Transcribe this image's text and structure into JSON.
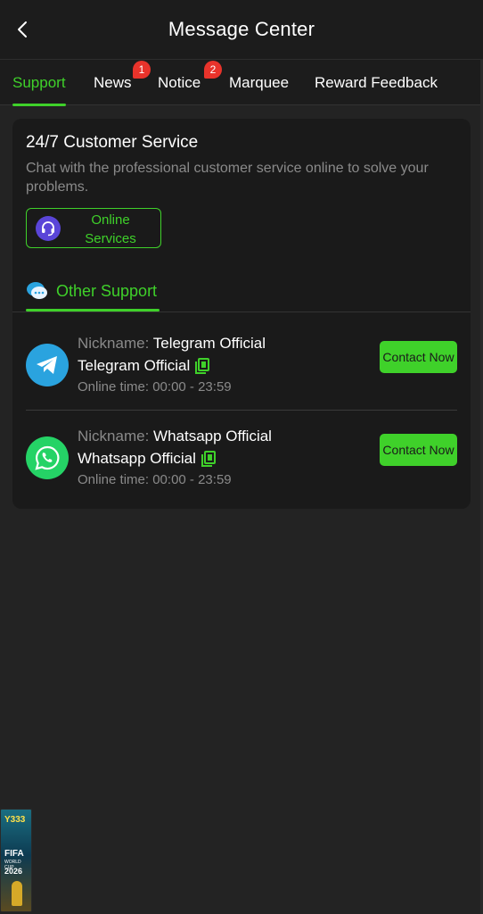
{
  "header": {
    "title": "Message Center",
    "back_icon": "chevron-left-icon"
  },
  "tabs": [
    {
      "label": "Support",
      "active": true,
      "badge": null
    },
    {
      "label": "News",
      "active": false,
      "badge": "1"
    },
    {
      "label": "Notice",
      "active": false,
      "badge": "2"
    },
    {
      "label": "Marquee",
      "active": false,
      "badge": null
    },
    {
      "label": "Reward Feedback",
      "active": false,
      "badge": null
    }
  ],
  "customer_service": {
    "title": "24/7 Customer Service",
    "description": "Chat with the professional customer service online to solve your problems.",
    "button_label": "Online Services",
    "button_icon": "headset-icon"
  },
  "other_support": {
    "label": "Other Support",
    "icon": "chat-bubble-icon"
  },
  "contacts": [
    {
      "icon": "telegram-icon",
      "nickname_key": "Nickname:",
      "nickname": "Telegram Official",
      "account": "Telegram Official",
      "online_time_key": "Online time:",
      "online_time": "00:00 - 23:59",
      "button": "Contact Now"
    },
    {
      "icon": "whatsapp-icon",
      "nickname_key": "Nickname:",
      "nickname": "Whatsapp Official",
      "account": "Whatsapp Official",
      "online_time_key": "Online time:",
      "online_time": "00:00 - 23:59",
      "button": "Contact Now"
    }
  ],
  "promo": {
    "logo": "Y333",
    "line1": "FIFA",
    "line2": "WORLD CUP",
    "line3": "2026"
  },
  "colors": {
    "accent": "#3fd12a",
    "background": "#232323",
    "card": "#1a1a1a",
    "badge": "#e8332b",
    "telegram": "#2aa3df",
    "whatsapp": "#25d366"
  }
}
